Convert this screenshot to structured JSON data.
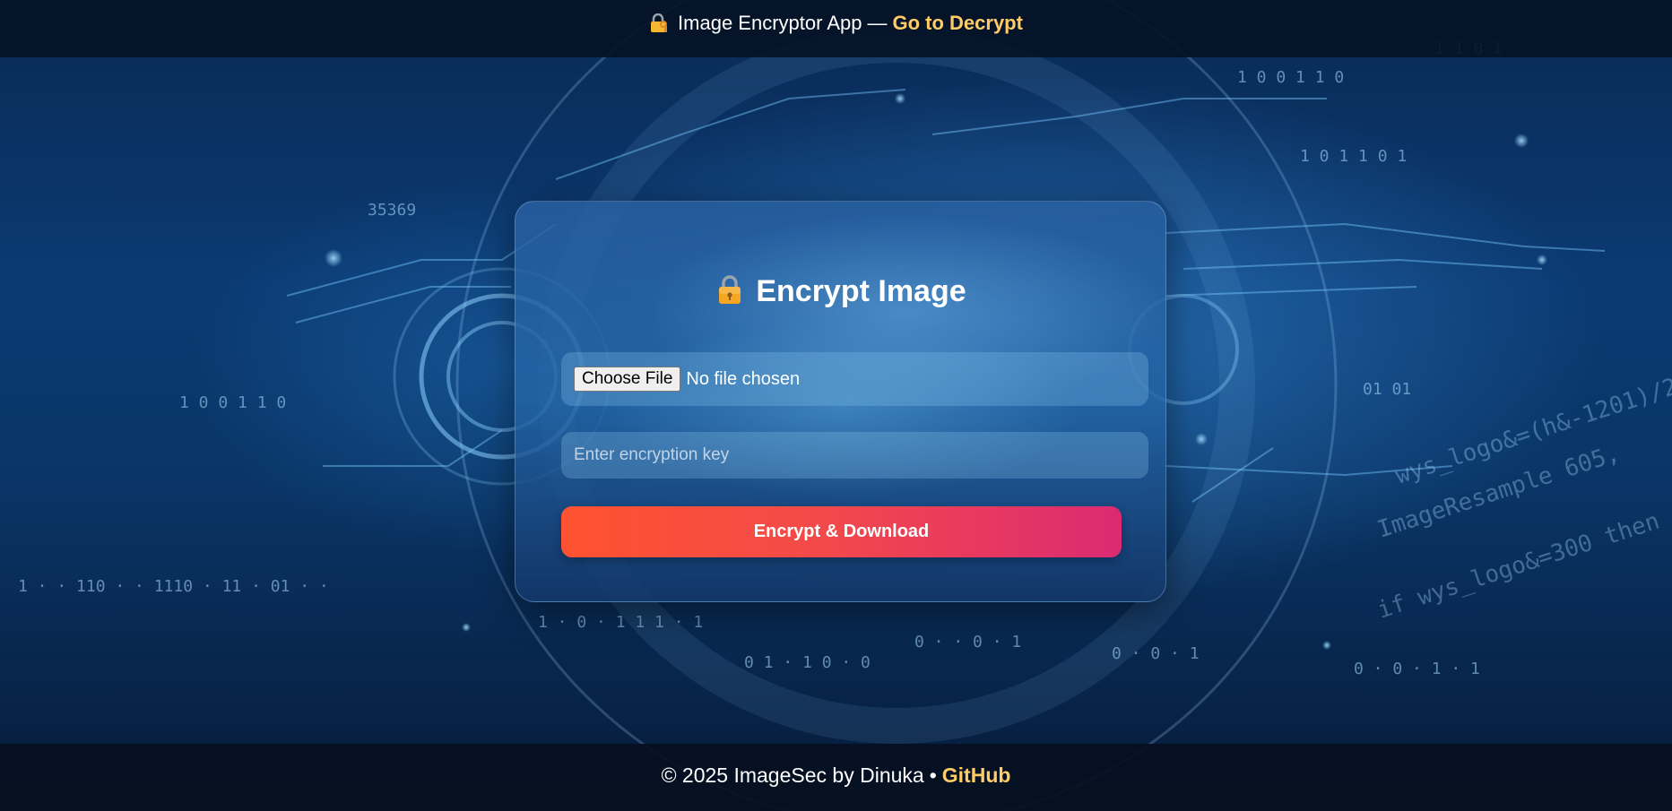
{
  "header": {
    "app_title": "Image Encryptor App",
    "separator": "—",
    "decrypt_link": "Go to Decrypt",
    "icon": "lock-with-key-icon"
  },
  "card": {
    "title": "Encrypt Image",
    "title_icon": "lock-icon",
    "file_input": {
      "button_label": "Choose File",
      "status": "No file chosen"
    },
    "key_input": {
      "value": "",
      "placeholder": "Enter encryption key"
    },
    "submit_label": "Encrypt & Download"
  },
  "footer": {
    "copyright": "© 2025 ImageSec by Dinuka",
    "bullet": "•",
    "github_link": "GitHub"
  },
  "colors": {
    "accent_link": "#ffcc66",
    "button_gradient_start": "#ff5230",
    "button_gradient_end": "#dc2a73",
    "background_dark": "#04152e"
  }
}
